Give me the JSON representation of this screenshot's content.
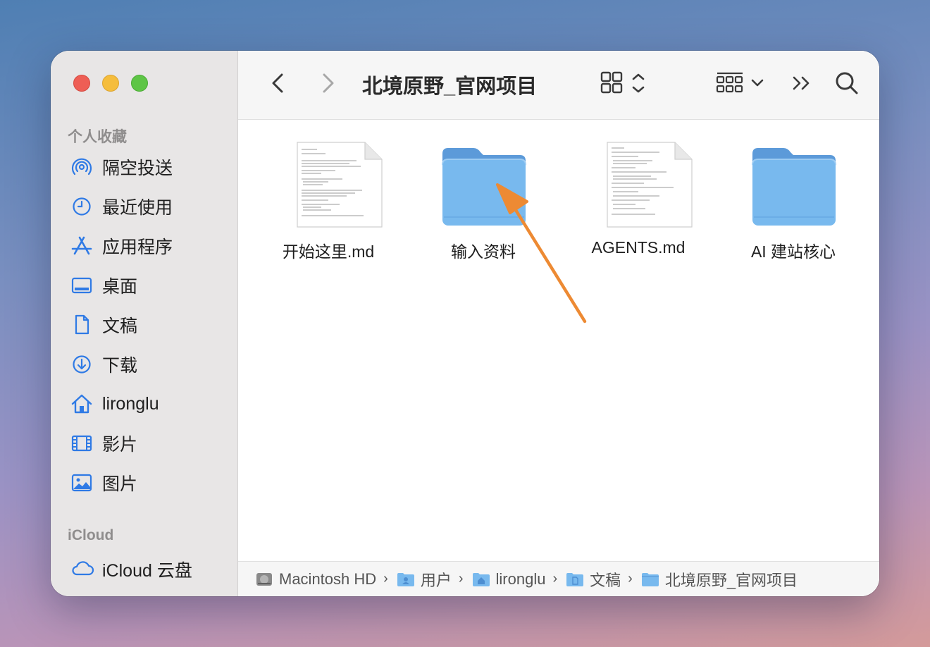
{
  "window": {
    "title": "北境原野_官网项目"
  },
  "sidebar": {
    "favorites_title": "个人收藏",
    "items": [
      {
        "label": "隔空投送",
        "icon": "airdrop-icon"
      },
      {
        "label": "最近使用",
        "icon": "clock-icon"
      },
      {
        "label": "应用程序",
        "icon": "applications-icon"
      },
      {
        "label": "桌面",
        "icon": "desktop-icon"
      },
      {
        "label": "文稿",
        "icon": "document-icon"
      },
      {
        "label": "下载",
        "icon": "download-icon"
      },
      {
        "label": "lironglu",
        "icon": "home-icon"
      },
      {
        "label": "影片",
        "icon": "film-icon"
      },
      {
        "label": "图片",
        "icon": "photo-icon"
      }
    ],
    "icloud_title": "iCloud",
    "icloud_item": {
      "label": "iCloud 云盘",
      "icon": "cloud-icon"
    }
  },
  "toolbar": {
    "back_icon": "chevron-left-icon",
    "forward_icon": "chevron-right-icon",
    "view_icon": "grid-view-icon",
    "group_icon": "group-icon",
    "more_icon": "double-chevron-icon",
    "search_icon": "search-icon"
  },
  "files": [
    {
      "name": "开始这里.md",
      "type": "document"
    },
    {
      "name": "输入资料",
      "type": "folder"
    },
    {
      "name": "AGENTS.md",
      "type": "document"
    },
    {
      "name": "AI 建站核心",
      "type": "folder"
    }
  ],
  "pathbar": [
    {
      "label": "Macintosh HD",
      "icon": "hard-drive-icon"
    },
    {
      "label": "用户",
      "icon": "users-folder-icon"
    },
    {
      "label": "lironglu",
      "icon": "home-folder-icon"
    },
    {
      "label": "文稿",
      "icon": "documents-folder-icon"
    },
    {
      "label": "北境原野_官网项目",
      "icon": "folder-icon"
    }
  ],
  "colors": {
    "folder": "#78b9ee",
    "folder_tab": "#5c9ad9",
    "accent_blue": "#2f7ae5",
    "annotation_arrow": "#ed8a33"
  }
}
